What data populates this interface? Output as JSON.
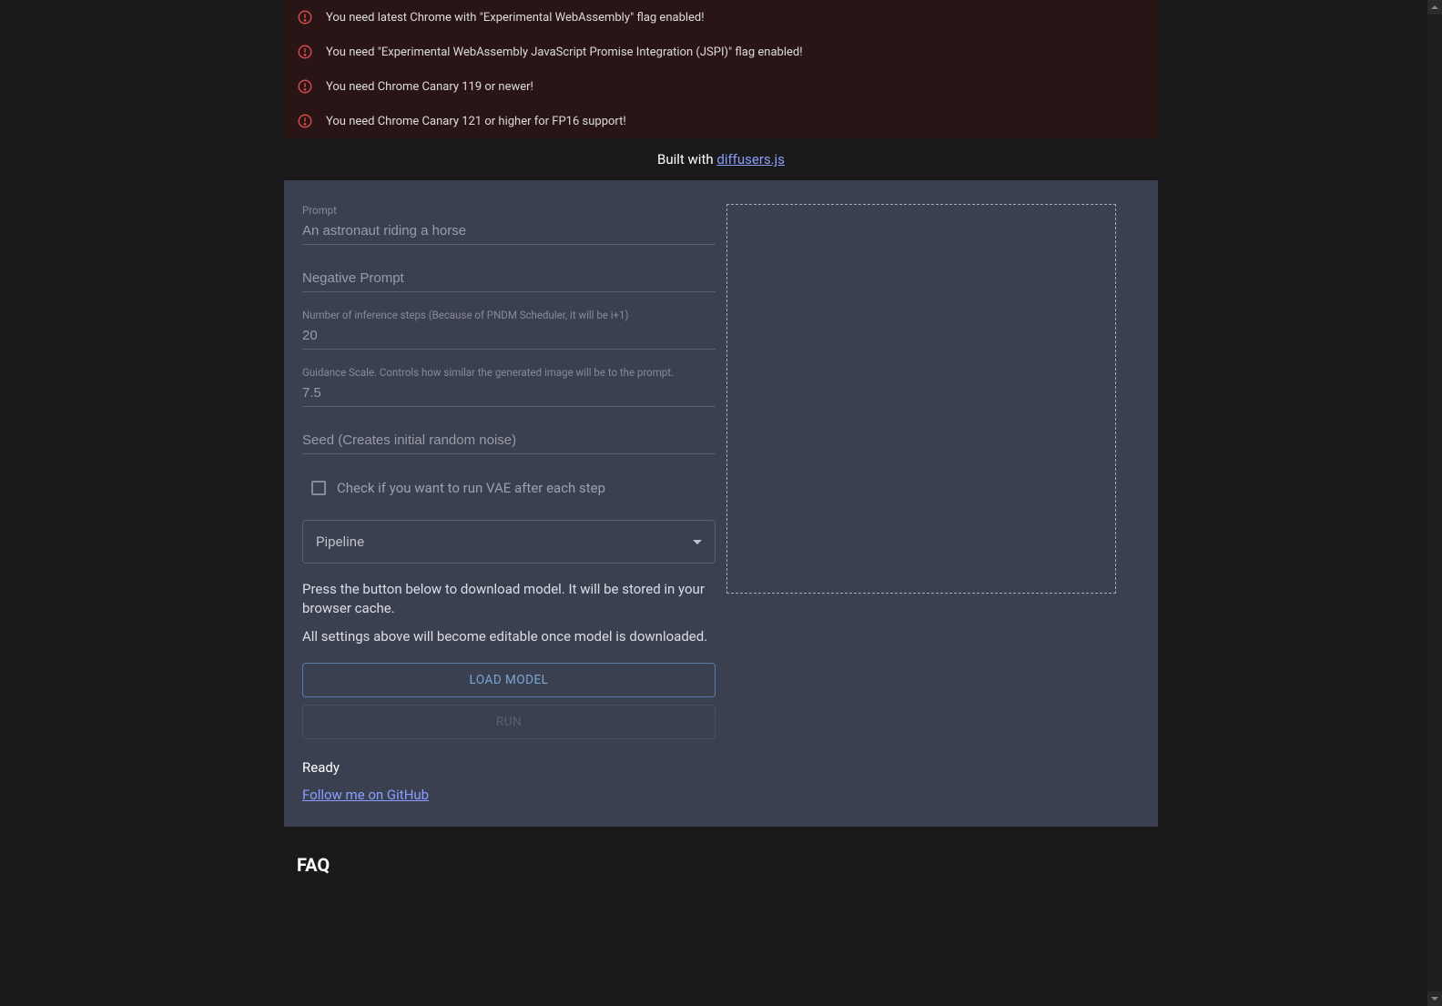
{
  "alerts": [
    "You need latest Chrome with \"Experimental WebAssembly\" flag enabled!",
    "You need \"Experimental WebAssembly JavaScript Promise Integration (JSPI)\" flag enabled!",
    "You need Chrome Canary 119 or newer!",
    "You need Chrome Canary 121 or higher for FP16 support!"
  ],
  "builtWith": {
    "prefix": "Built with ",
    "linkText": "diffusers.js"
  },
  "form": {
    "prompt": {
      "label": "Prompt",
      "placeholder": "An astronaut riding a horse"
    },
    "negativePrompt": {
      "placeholder": "Negative Prompt"
    },
    "steps": {
      "label": "Number of inference steps (Because of PNDM Scheduler, it will be i+1)",
      "value": "20"
    },
    "guidance": {
      "label": "Guidance Scale. Controls how similar the generated image will be to the prompt.",
      "value": "7.5"
    },
    "seed": {
      "placeholder": "Seed (Creates initial random noise)"
    },
    "vaeCheckbox": {
      "label": "Check if you want to run VAE after each step"
    },
    "pipelineSelect": {
      "placeholder": "Pipeline"
    },
    "infoText1": "Press the button below to download model. It will be stored in your browser cache.",
    "infoText2": "All settings above will become editable once model is downloaded.",
    "loadButton": "Load model",
    "runButton": "Run",
    "status": "Ready",
    "githubLink": "Follow me on GitHub"
  },
  "faq": {
    "heading": "FAQ"
  }
}
